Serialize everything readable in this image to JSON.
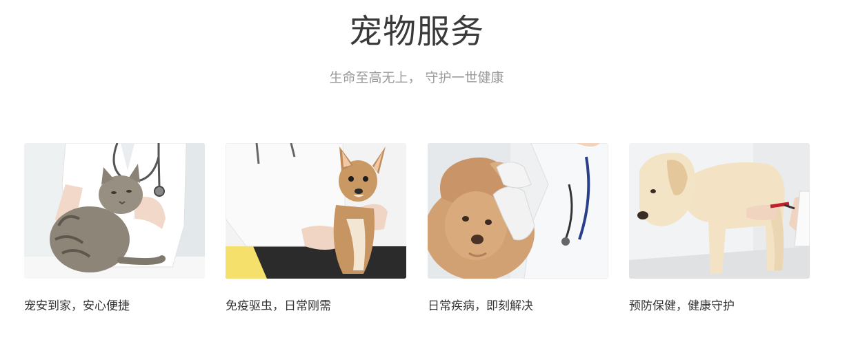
{
  "section": {
    "title": "宠物服务",
    "subtitle": "生命至高无上， 守护一世健康"
  },
  "services": [
    {
      "caption": "宠安到家，安心便捷",
      "image": "vet-examining-tabby-cat"
    },
    {
      "caption": "免疫驱虫，日常刚需",
      "image": "vet-holding-chihuahua"
    },
    {
      "caption": "日常疾病，即刻解决",
      "image": "vet-checking-shaggy-dog-ear"
    },
    {
      "caption": "预防保健，健康守护",
      "image": "vet-trimming-labrador-nails"
    }
  ]
}
